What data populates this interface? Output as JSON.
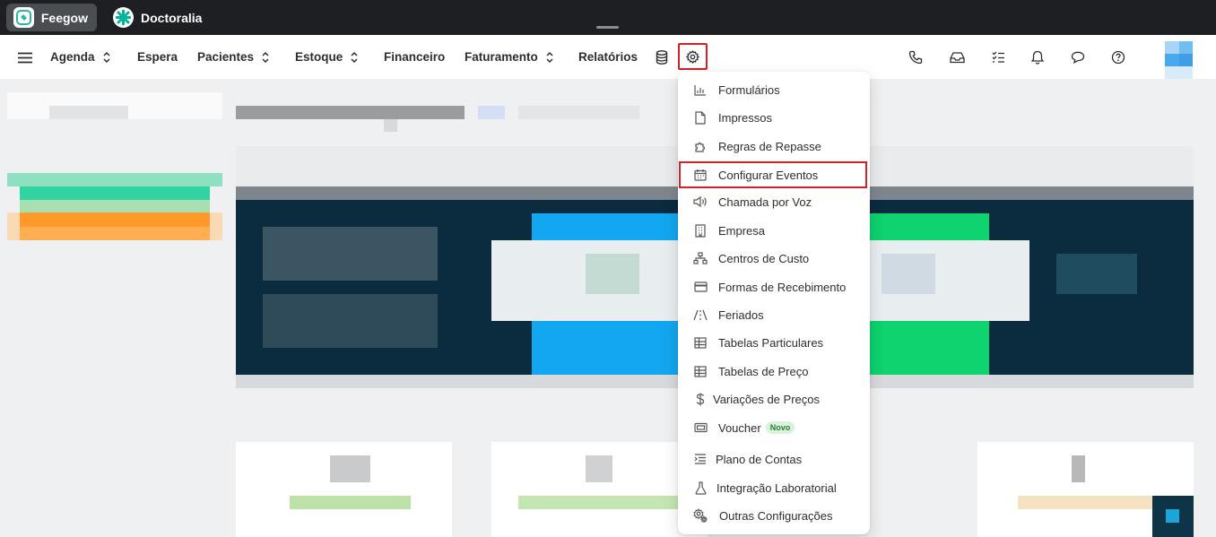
{
  "apps": [
    {
      "label": "Feegow"
    },
    {
      "label": "Doctoralia"
    }
  ],
  "nav": {
    "items": [
      {
        "label": "Agenda"
      },
      {
        "label": "Espera"
      },
      {
        "label": "Pacientes"
      },
      {
        "label": "Estoque"
      },
      {
        "label": "Financeiro"
      },
      {
        "label": "Faturamento"
      },
      {
        "label": "Relatórios"
      }
    ],
    "right_icons": [
      "phone-icon",
      "inbox-icon",
      "tasks-icon",
      "bell-icon",
      "chat-icon",
      "help-icon"
    ]
  },
  "settings_menu": {
    "items": [
      {
        "label": "Formulários",
        "icon": "bar-chart-icon"
      },
      {
        "label": "Impressos",
        "icon": "document-icon"
      },
      {
        "label": "Regras de Repasse",
        "icon": "puzzle-icon"
      },
      {
        "label": "Configurar Eventos",
        "icon": "calendar-icon"
      },
      {
        "label": "Chamada por Voz",
        "icon": "speaker-icon"
      },
      {
        "label": "Empresa",
        "icon": "building-icon"
      },
      {
        "label": "Centros de Custo",
        "icon": "hierarchy-icon"
      },
      {
        "label": "Formas de Recebimento",
        "icon": "credit-card-icon"
      },
      {
        "label": "Feriados",
        "icon": "road-icon"
      },
      {
        "label": "Tabelas Particulares",
        "icon": "table-icon"
      },
      {
        "label": "Tabelas de Preço",
        "icon": "table-icon"
      },
      {
        "label": "Variações de Preços",
        "icon": "dollar-icon"
      },
      {
        "label": "Voucher",
        "icon": "ticket-icon",
        "badge": "Novo"
      },
      {
        "label": "Plano de Contas",
        "icon": "list-indent-icon"
      },
      {
        "label": "Integração Laboratorial",
        "icon": "flask-icon"
      },
      {
        "label": "Outras Configurações",
        "icon": "gears-icon"
      }
    ]
  },
  "colors": {
    "highlight_border": "#d32027",
    "hero_bg": "#0b2b3e",
    "topbar_bg": "#1d1f22"
  }
}
